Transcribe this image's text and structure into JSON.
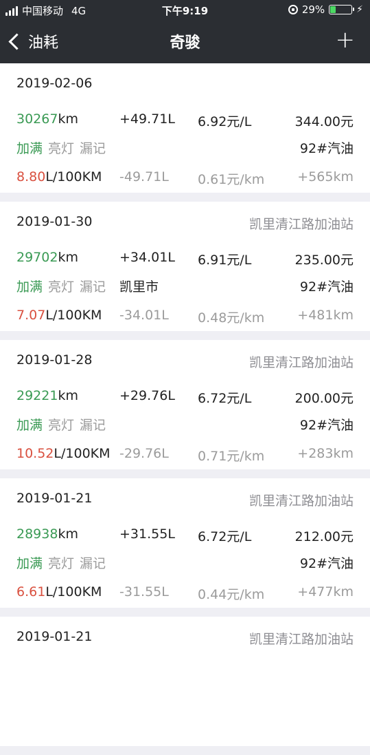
{
  "status_bar": {
    "carrier": "中国移动",
    "network": "4G",
    "time": "下午9:19",
    "battery_percent": "29%",
    "battery_level": 0.29,
    "signal_bars": 4
  },
  "nav": {
    "back_label": "油耗",
    "title": "奇骏",
    "add_label": "+"
  },
  "colors": {
    "bar_bg": "#2b2e33",
    "green": "#3a9a54",
    "red": "#d9503f",
    "gray": "#9b9b9b"
  },
  "records": [
    {
      "date": "2019-02-06",
      "station": "",
      "odometer": "30267",
      "odometer_unit": "km",
      "volume": "+49.71L",
      "price": "6.92元/L",
      "amount": "344.00元",
      "tags": [
        "加满",
        "亮灯",
        "漏记"
      ],
      "city": "",
      "fuel_type": "92#汽油",
      "consumption": "8.80",
      "consumption_unit": "L/100KM",
      "volume_delta": "-49.71L",
      "cost_per_km": "0.61元/km",
      "distance": "+565km"
    },
    {
      "date": "2019-01-30",
      "station": "凯里清江路加油站",
      "odometer": "29702",
      "odometer_unit": "km",
      "volume": "+34.01L",
      "price": "6.91元/L",
      "amount": "235.00元",
      "tags": [
        "加满",
        "亮灯",
        "漏记"
      ],
      "city": "凯里市",
      "fuel_type": "92#汽油",
      "consumption": "7.07",
      "consumption_unit": "L/100KM",
      "volume_delta": "-34.01L",
      "cost_per_km": "0.48元/km",
      "distance": "+481km"
    },
    {
      "date": "2019-01-28",
      "station": "凯里清江路加油站",
      "odometer": "29221",
      "odometer_unit": "km",
      "volume": "+29.76L",
      "price": "6.72元/L",
      "amount": "200.00元",
      "tags": [
        "加满",
        "亮灯",
        "漏记"
      ],
      "city": "",
      "fuel_type": "92#汽油",
      "consumption": "10.52",
      "consumption_unit": "L/100KM",
      "volume_delta": "-29.76L",
      "cost_per_km": "0.71元/km",
      "distance": "+283km"
    },
    {
      "date": "2019-01-21",
      "station": "凯里清江路加油站",
      "odometer": "28938",
      "odometer_unit": "km",
      "volume": "+31.55L",
      "price": "6.72元/L",
      "amount": "212.00元",
      "tags": [
        "加满",
        "亮灯",
        "漏记"
      ],
      "city": "",
      "fuel_type": "92#汽油",
      "consumption": "6.61",
      "consumption_unit": "L/100KM",
      "volume_delta": "-31.55L",
      "cost_per_km": "0.44元/km",
      "distance": "+477km"
    },
    {
      "date": "2019-01-21",
      "station": "凯里清江路加油站"
    }
  ]
}
